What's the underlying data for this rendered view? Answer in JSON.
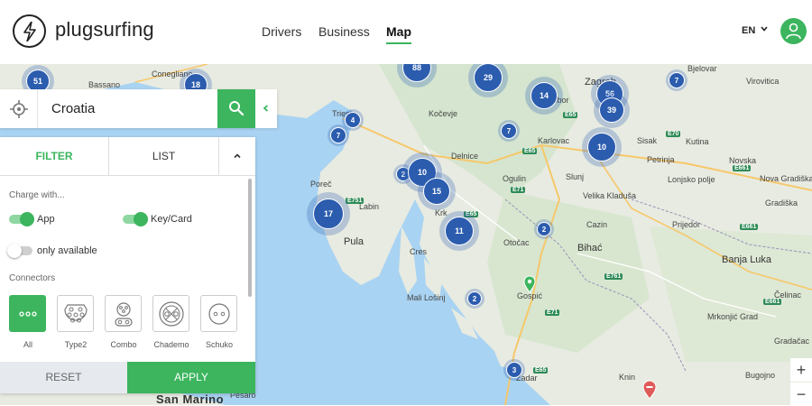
{
  "header": {
    "logo_text": "plugsurfing",
    "nav": [
      "Drivers",
      "Business",
      "Map"
    ],
    "active_nav": "Map",
    "language": "EN"
  },
  "search": {
    "value": "Croatia"
  },
  "panel": {
    "tabs": {
      "filter": "FILTER",
      "list": "LIST"
    },
    "charge_with_label": "Charge with...",
    "toggles": [
      {
        "label": "App",
        "on": true
      },
      {
        "label": "Key/Card",
        "on": true
      },
      {
        "label": "only available",
        "on": false
      }
    ],
    "connectors_label": "Connectors",
    "connectors": [
      {
        "label": "All",
        "icon": "all-connectors-icon",
        "selected": true
      },
      {
        "label": "Type2",
        "icon": "type2-plug-icon",
        "selected": false
      },
      {
        "label": "Combo",
        "icon": "combo-plug-icon",
        "selected": false
      },
      {
        "label": "Chademo",
        "icon": "chademo-plug-icon",
        "selected": false
      },
      {
        "label": "Schuko",
        "icon": "schuko-plug-icon",
        "selected": false
      }
    ],
    "reset_label": "RESET",
    "apply_label": "APPLY"
  },
  "map": {
    "clusters": [
      "51",
      "18",
      "88",
      "29",
      "14",
      "56",
      "39",
      "7",
      "4",
      "7",
      "7",
      "10",
      "2",
      "10",
      "15",
      "17",
      "11",
      "2",
      "2",
      "3"
    ],
    "places": [
      "Bassano",
      "Conegliano",
      "Trieste",
      "Kočevje",
      "Karlovac",
      "Sisak",
      "Bjelovar",
      "Virovitica",
      "Kutina",
      "Novska",
      "Nova Gradiška",
      "Gradiška",
      "Poreč",
      "Labin",
      "Pula",
      "Krk",
      "Delnice",
      "Ogulin",
      "Slunj",
      "Velika Kladuša",
      "Cazin",
      "Bihać",
      "Otočac",
      "Prijedor",
      "Banja Luka",
      "Lonjsko polje",
      "Gospić",
      "Mali Lošinj",
      "Cres",
      "Zadar",
      "Mrkonjić Grad",
      "Bugojno",
      "Knin",
      "Petrinja",
      "Zagreb",
      "Samobor",
      "San Marino",
      "Pesaro",
      "Čelinac",
      "Gradačac"
    ],
    "zoom_in": "+",
    "zoom_out": "−"
  }
}
